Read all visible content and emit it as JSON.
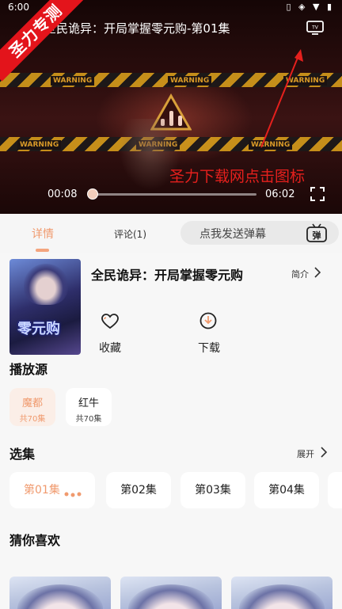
{
  "status_bar": {
    "time": "6:00",
    "icons": "▯ ◈ ▼ ▮"
  },
  "player": {
    "title": "全民诡异：开局掌握零元购-第01集",
    "warning_text": "WARNING",
    "time_current": "00:08",
    "time_total": "06:02",
    "progress_fraction": 0.022
  },
  "overlay": {
    "banner_text": "圣力专测",
    "promo_text": "圣力下载网点击图标",
    "accent_color": "#e5201d"
  },
  "tabs": {
    "detail": "详情",
    "comments": "评论(1)",
    "danmu_placeholder": "点我发送弹幕",
    "danmu_icon_glyph": "弹"
  },
  "show": {
    "title": "全民诡异：开局掌握零元购",
    "intro_label": "简介",
    "cover_text": "零元购",
    "favorite_label": "收藏",
    "download_label": "下载"
  },
  "sources": {
    "heading": "播放源",
    "items": [
      {
        "name": "魔都",
        "count": "共70集"
      },
      {
        "name": "红牛",
        "count": "共70集"
      }
    ]
  },
  "episodes": {
    "heading": "选集",
    "expand_label": "展开",
    "items": [
      "第01集",
      "第02集",
      "第03集",
      "第04集"
    ]
  },
  "recommend": {
    "heading": "猜你喜欢"
  },
  "colors": {
    "accent": "#f09a6e",
    "accent_bg": "#fbeee7"
  }
}
